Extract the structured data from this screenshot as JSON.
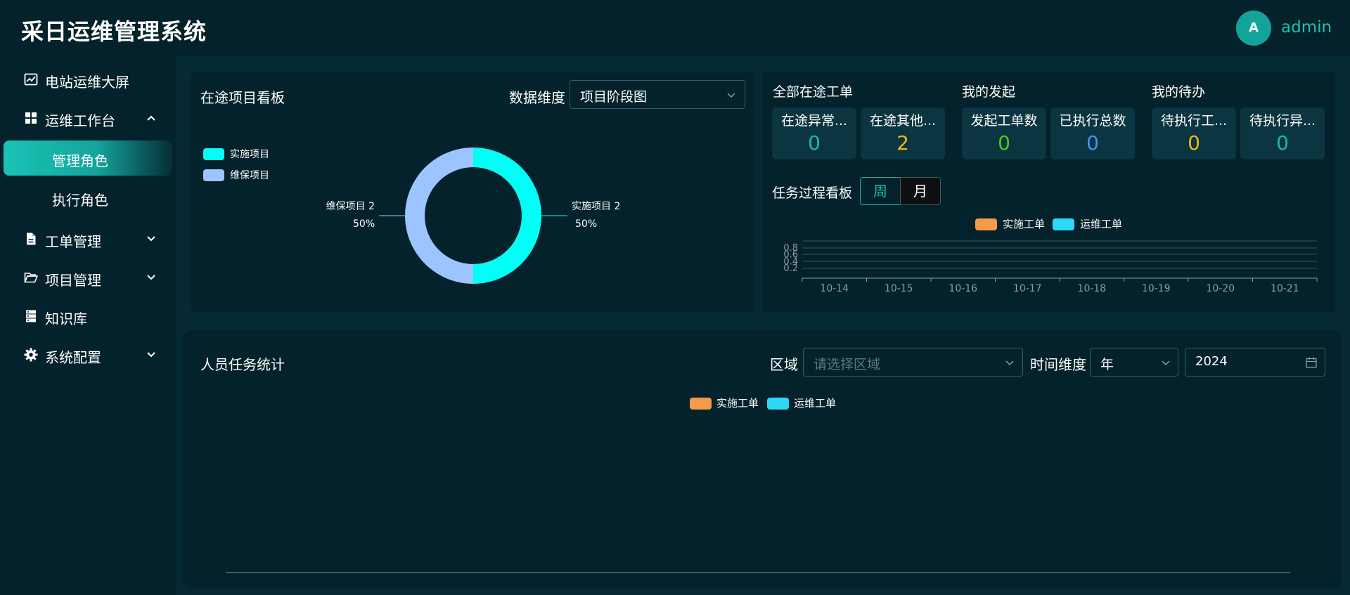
{
  "app": {
    "title": "采日运维管理系统"
  },
  "user": {
    "avatar_letter": "A",
    "name": "admin"
  },
  "sidebar": {
    "items": [
      {
        "label": "电站运维大屏",
        "icon": "chart-line-icon"
      },
      {
        "label": "运维工作台",
        "icon": "dashboard-grid-icon",
        "expanded": true
      },
      {
        "label": "管理角色",
        "sub": true,
        "active": true
      },
      {
        "label": "执行角色",
        "sub": true
      },
      {
        "label": "工单管理",
        "icon": "document-icon",
        "expanded": false
      },
      {
        "label": "项目管理",
        "icon": "folder-open-icon",
        "expanded": false
      },
      {
        "label": "知识库",
        "icon": "server-icon"
      },
      {
        "label": "系统配置",
        "icon": "gear-icon",
        "expanded": false
      }
    ]
  },
  "project_board": {
    "title": "在途项目看板",
    "dimension_label": "数据维度",
    "dimension_value": "项目阶段图",
    "chart_data": {
      "type": "pie",
      "donut": true,
      "legend_position": "top-left",
      "slices": [
        {
          "name": "实施项目",
          "value": 2,
          "percent": "50%",
          "color": "#00fff6"
        },
        {
          "name": "维保项目",
          "value": 2,
          "percent": "50%",
          "color": "#9cc5ff"
        }
      ]
    }
  },
  "work_orders": {
    "groups": [
      {
        "title": "全部在途工单",
        "cards": [
          {
            "label": "在途异常...",
            "value": "0",
            "color": "#1fb5ad"
          },
          {
            "label": "在途其他...",
            "value": "2",
            "color": "#f5b21c"
          }
        ]
      },
      {
        "title": "我的发起",
        "cards": [
          {
            "label": "发起工单数",
            "value": "0",
            "color": "#52c41a"
          },
          {
            "label": "已执行总数",
            "value": "0",
            "color": "#4b8cf5"
          }
        ]
      },
      {
        "title": "我的待办",
        "cards": [
          {
            "label": "待执行工...",
            "value": "0",
            "color": "#f5b21c"
          },
          {
            "label": "待执行异...",
            "value": "0",
            "color": "#1fb5ad"
          }
        ]
      }
    ]
  },
  "task_board": {
    "title": "任务过程看板",
    "tabs": [
      {
        "label": "周",
        "active": true
      },
      {
        "label": "月",
        "active": false
      }
    ],
    "chart_data": {
      "type": "bar",
      "categories": [
        "10-14",
        "10-15",
        "10-16",
        "10-17",
        "10-18",
        "10-19",
        "10-20",
        "10-21"
      ],
      "series": [
        {
          "name": "实施工单",
          "values": [
            0,
            0,
            0,
            0,
            0,
            0,
            0,
            0
          ],
          "color": "#f59a4b"
        },
        {
          "name": "运维工单",
          "values": [
            0,
            0,
            0,
            0,
            0,
            0,
            0,
            0
          ],
          "color": "#2fd8f5"
        }
      ],
      "y_ticks": [
        "0.8",
        "0.6",
        "0.4",
        "0.2"
      ],
      "grid": true,
      "legend_position": "top-center"
    }
  },
  "personnel": {
    "title": "人员任务统计",
    "region_label": "区域",
    "region_placeholder": "请选择区域",
    "time_label": "时间维度",
    "time_value": "年",
    "year_value": "2024",
    "chart_data": {
      "type": "bar",
      "categories": [],
      "series": [
        {
          "name": "实施工单",
          "values": [],
          "color": "#f59a4b"
        },
        {
          "name": "运维工单",
          "values": [],
          "color": "#2fd8f5"
        }
      ],
      "legend_position": "top-center"
    }
  }
}
